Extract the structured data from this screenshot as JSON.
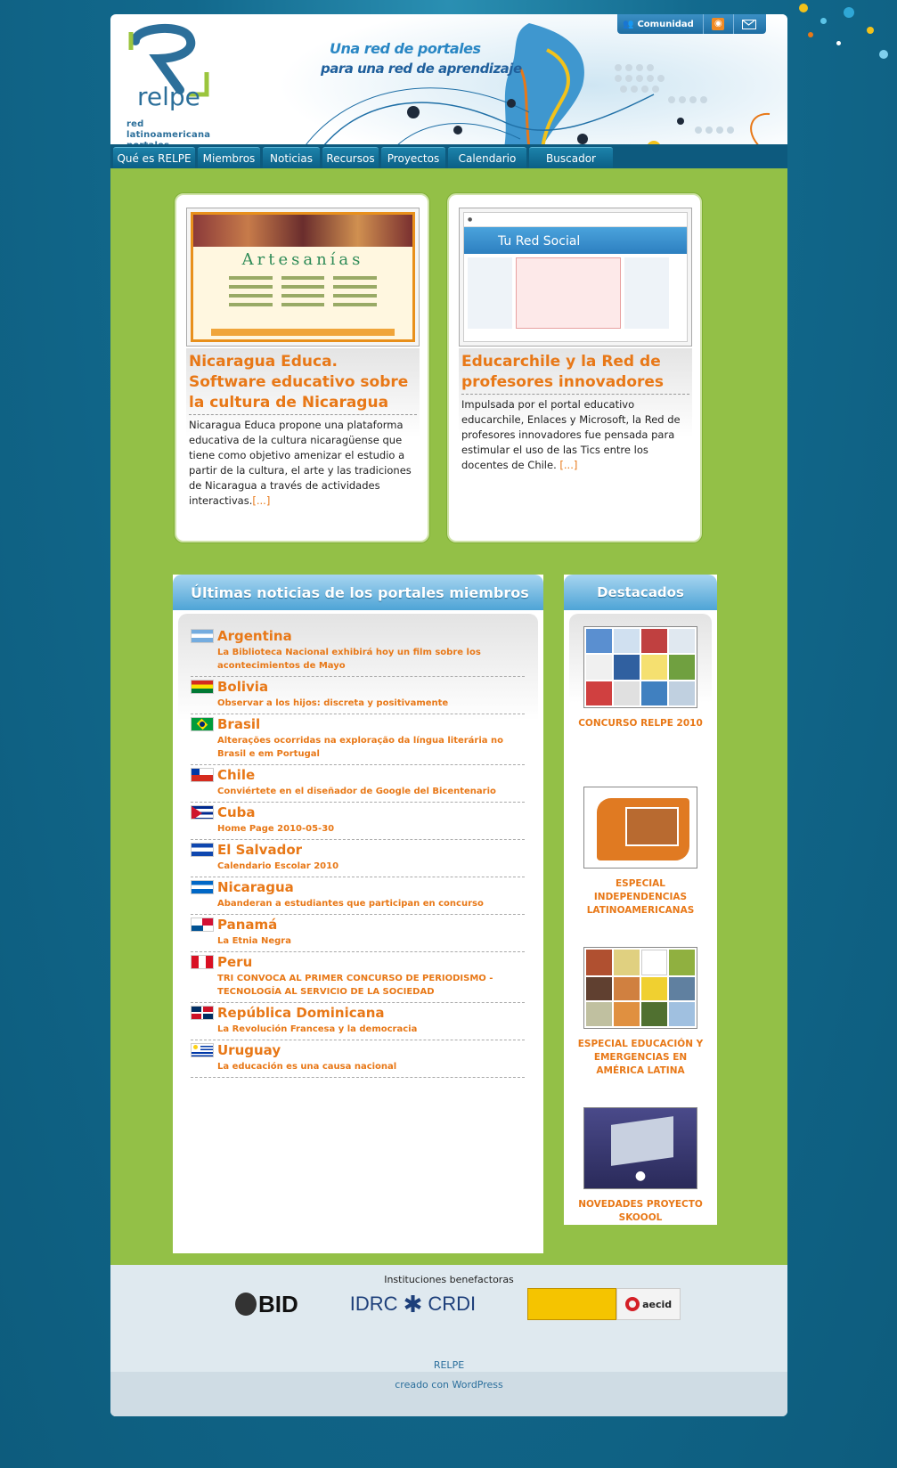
{
  "topbar": {
    "community": "Comunidad",
    "icons": [
      "community-icon",
      "rss-icon",
      "mail-icon"
    ]
  },
  "header": {
    "tagline_line1": "Una red de portales",
    "tagline_line2": "para una red de aprendizaje",
    "logo_text": "relpe",
    "logo_sub1": "red latinoamericana",
    "logo_sub2": "portales educativos"
  },
  "nav": [
    "Qué es RELPE",
    "Miembros",
    "Noticias",
    "Recursos",
    "Proyectos",
    "Calendario",
    "Buscador"
  ],
  "featured": [
    {
      "title": "Nicaragua Educa. Software educativo sobre la cultura de Nicaragua",
      "body": "Nicaragua Educa propone una plataforma educativa de la cultura nicaragüense que tiene como objetivo amenizar el estudio a partir de la cultura, el arte y las tradiciones de Nicaragua a través de actividades interactivas.",
      "more": "[...]",
      "shot_title": "Artesanías"
    },
    {
      "title": "Educarchile y la Red de profesores innovadores",
      "body": "Impulsada por el portal educativo educarchile, Enlaces y Microsoft, la Red de profesores innovadores fue pensada para estimular el uso de las Tics entre los docentes de Chile.",
      "more": "[...]",
      "shot_title": "Tu Red Social"
    }
  ],
  "news": {
    "title": "Últimas noticias de los portales miembros",
    "items": [
      {
        "country": "Argentina",
        "headline": "La Biblioteca Nacional exhibirá hoy un film sobre los acontecimientos de Mayo"
      },
      {
        "country": "Bolivia",
        "headline": "Observar a los hijos: discreta y positivamente"
      },
      {
        "country": "Brasil",
        "headline": "Alterações ocorridas na exploração da língua literária no Brasil e em Portugal"
      },
      {
        "country": "Chile",
        "headline": "Conviértete en el diseñador de Google del Bicentenario"
      },
      {
        "country": "Cuba",
        "headline": "Home Page 2010-05-30"
      },
      {
        "country": "El Salvador",
        "headline": "Calendario Escolar 2010"
      },
      {
        "country": "Nicaragua",
        "headline": "Abanderan a estudiantes que participan en concurso"
      },
      {
        "country": "Panamá",
        "headline": "La Etnia Negra"
      },
      {
        "country": "Peru",
        "headline": "TRI CONVOCA AL PRIMER CONCURSO DE PERIODISMO - TECNOLOGÍA AL SERVICIO DE LA SOCIEDAD"
      },
      {
        "country": "República Dominicana",
        "headline": "La Revolución Francesa y la democracia"
      },
      {
        "country": "Uruguay",
        "headline": "La educación es una causa nacional"
      }
    ]
  },
  "destacados": {
    "title": "Destacados",
    "items": [
      {
        "caption": "CONCURSO RELPE 2010"
      },
      {
        "caption": "ESPECIAL INDEPENDENCIAS LATINOAMERICANAS"
      },
      {
        "caption": "ESPECIAL EDUCACIÓN Y EMERGENCIAS EN AMÉRICA LATINA"
      },
      {
        "caption": "NOVEDADES PROYECTO SKOOOL"
      }
    ]
  },
  "footer": {
    "institutions": "Instituciones benefactoras",
    "logos": [
      "BID",
      "IDRC",
      "CRDI",
      "aecid"
    ],
    "site": "RELPE",
    "created": "creado con",
    "wordpress": "WordPress"
  },
  "colors": {
    "accent": "#e87817",
    "green": "#93c047",
    "blue": "#0d5a7e"
  }
}
